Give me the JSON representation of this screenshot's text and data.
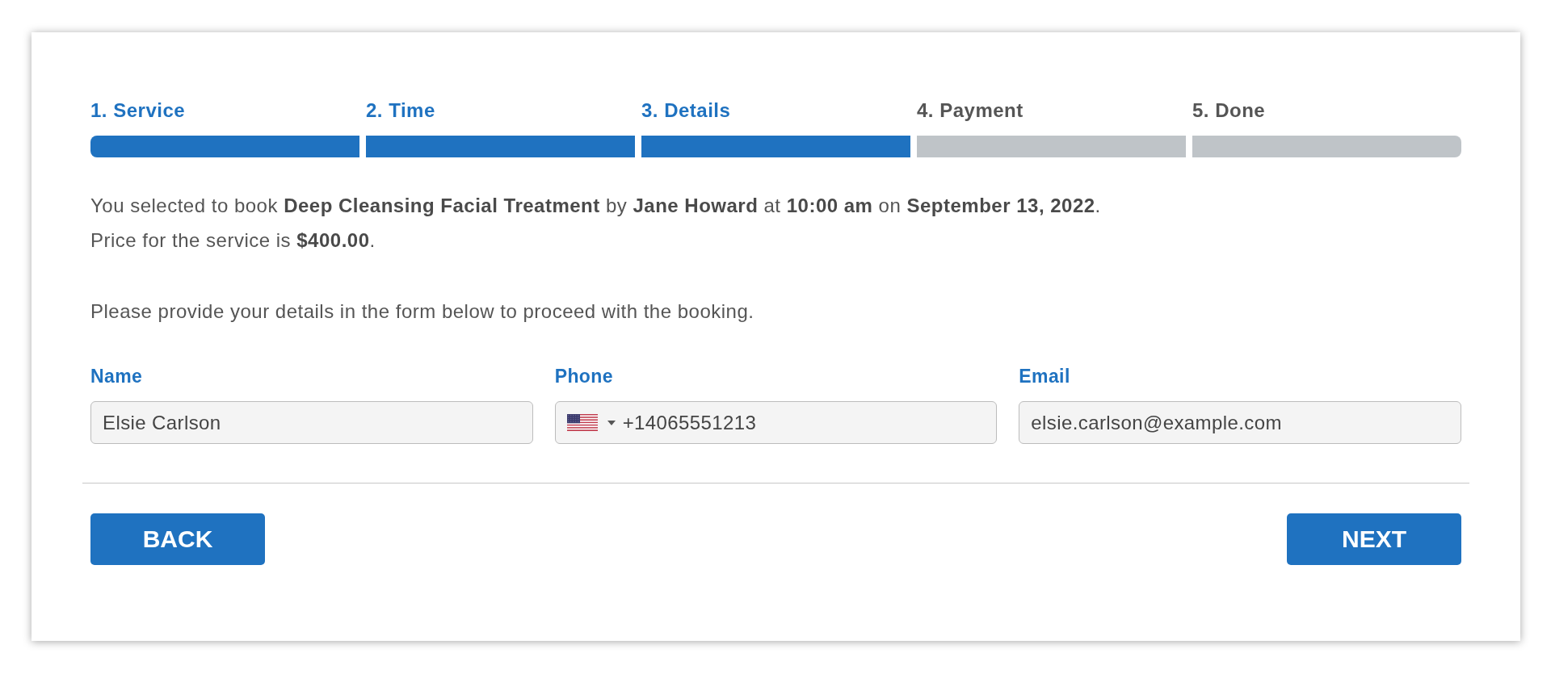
{
  "steps": [
    {
      "label": "1. Service",
      "completed": true
    },
    {
      "label": "2. Time",
      "completed": true
    },
    {
      "label": "3. Details",
      "completed": true
    },
    {
      "label": "4. Payment",
      "completed": false
    },
    {
      "label": "5. Done",
      "completed": false
    }
  ],
  "summary": [
    "You selected to book **Deep Cleansing Facial Treatment** by **Jane Howard** at **10:00 am** on **September 13, 2022**.",
    "Price for the service is **$400.00**."
  ],
  "instructions": "Please provide your details in the form below to proceed with the booking.",
  "fields": [
    {
      "label": "Name",
      "kind": "text",
      "value": "Elsie Carlson"
    },
    {
      "label": "Phone",
      "kind": "phone",
      "value": "+14065551213"
    },
    {
      "label": "Email",
      "kind": "text",
      "value": "elsie.carlson@example.com"
    }
  ],
  "buttons": {
    "back": "BACK",
    "next": "NEXT"
  }
}
